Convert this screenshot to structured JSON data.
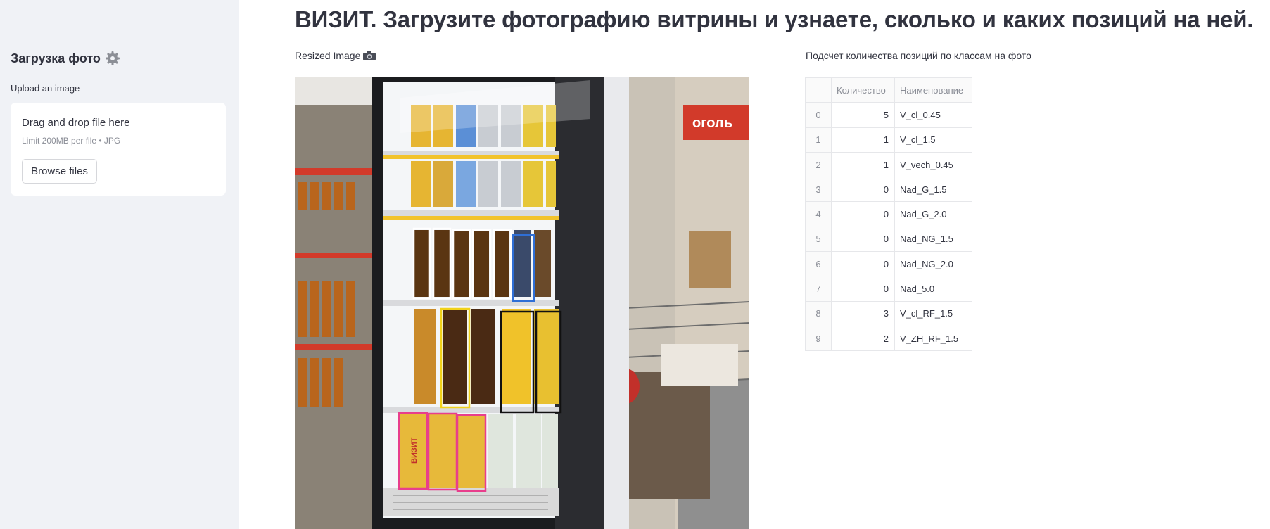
{
  "sidebar": {
    "title": "Загрузка фото",
    "title_icon": "gear-icon",
    "upload_label": "Upload an image",
    "dropzone": {
      "title": "Drag and drop file here",
      "limit": "Limit 200MB per file • JPG",
      "button_label": "Browse files"
    }
  },
  "main": {
    "title": "ВИЗИТ. Загрузите фотографию витрины и узнаете, сколько и каких позиций на ней.",
    "image_caption": "Resized Image",
    "image_caption_icon": "camera-icon",
    "photo_labels": {
      "brand_sign": "ВИЗИТ",
      "store_sign": "оголь"
    },
    "table_caption": "Подсчет количества позиций по классам на фото",
    "table": {
      "columns": [
        "",
        "Количество",
        "Наименование"
      ],
      "rows": [
        {
          "index": "0",
          "count": "5",
          "name": "V_cl_0.45"
        },
        {
          "index": "1",
          "count": "1",
          "name": "V_cl_1.5"
        },
        {
          "index": "2",
          "count": "1",
          "name": "V_vech_0.45"
        },
        {
          "index": "3",
          "count": "0",
          "name": "Nad_G_1.5"
        },
        {
          "index": "4",
          "count": "0",
          "name": "Nad_G_2.0"
        },
        {
          "index": "5",
          "count": "0",
          "name": "Nad_NG_1.5"
        },
        {
          "index": "6",
          "count": "0",
          "name": "Nad_NG_2.0"
        },
        {
          "index": "7",
          "count": "0",
          "name": "Nad_5.0"
        },
        {
          "index": "8",
          "count": "3",
          "name": "V_cl_RF_1.5"
        },
        {
          "index": "9",
          "count": "2",
          "name": "V_ZH_RF_1.5"
        }
      ]
    }
  },
  "colors": {
    "sidebar_bg": "#f0f2f6",
    "text": "#31333f",
    "muted": "#8a8d96",
    "box_white": "#ffffff",
    "box_blue": "#2f6fd6",
    "box_yellow": "#f1d21a",
    "box_black": "#111111",
    "box_pink": "#e83e8c"
  }
}
